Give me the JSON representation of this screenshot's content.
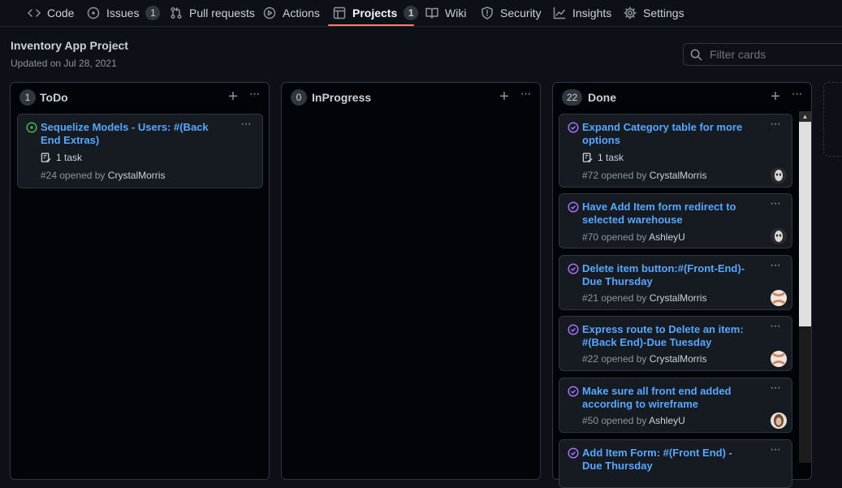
{
  "nav": {
    "tabs": [
      {
        "label": "Code",
        "icon": "code-icon"
      },
      {
        "label": "Issues",
        "icon": "issue-icon",
        "count": "1"
      },
      {
        "label": "Pull requests",
        "icon": "pull-request-icon"
      },
      {
        "label": "Actions",
        "icon": "play-icon"
      },
      {
        "label": "Projects",
        "icon": "table-icon",
        "count": "1",
        "selected": true
      },
      {
        "label": "Wiki",
        "icon": "book-icon"
      },
      {
        "label": "Security",
        "icon": "shield-icon"
      },
      {
        "label": "Insights",
        "icon": "graph-icon"
      },
      {
        "label": "Settings",
        "icon": "gear-icon"
      }
    ],
    "accent": "#f78166"
  },
  "project": {
    "title": "Inventory App Project",
    "updated": "Updated on Jul 28, 2021"
  },
  "filter": {
    "placeholder": "Filter cards"
  },
  "columns": [
    {
      "name": "ToDo",
      "count": "1",
      "cards": [
        {
          "title": "Sequelize Models - Users: #(Back End Extras)",
          "tasks": "1 task",
          "number": "#24",
          "opened_by": "opened by",
          "author": "CrystalMorris",
          "state": "open"
        }
      ]
    },
    {
      "name": "InProgress",
      "count": "0",
      "cards": []
    },
    {
      "name": "Done",
      "count": "22",
      "cards": [
        {
          "title": "Expand Category table for more options",
          "tasks": "1 task",
          "number": "#72",
          "opened_by": "opened by",
          "author": "CrystalMorris",
          "state": "closed"
        },
        {
          "title": "Have Add Item form redirect to selected warehouse",
          "number": "#70",
          "opened_by": "opened by",
          "author": "AshleyU",
          "state": "closed"
        },
        {
          "title": "Delete item button:#(Front-End)- Due Thursday",
          "number": "#21",
          "opened_by": "opened by",
          "author": "CrystalMorris",
          "state": "closed"
        },
        {
          "title": "Express route to Delete an item: #(Back End)-Due Tuesday",
          "number": "#22",
          "opened_by": "opened by",
          "author": "CrystalMorris",
          "state": "closed"
        },
        {
          "title": "Make sure all front end added according to wireframe",
          "number": "#50",
          "opened_by": "opened by",
          "author": "AshleyU",
          "state": "closed"
        },
        {
          "title": "Add Item Form: #(Front End) -Due Thursday",
          "state": "closed"
        }
      ]
    }
  ]
}
